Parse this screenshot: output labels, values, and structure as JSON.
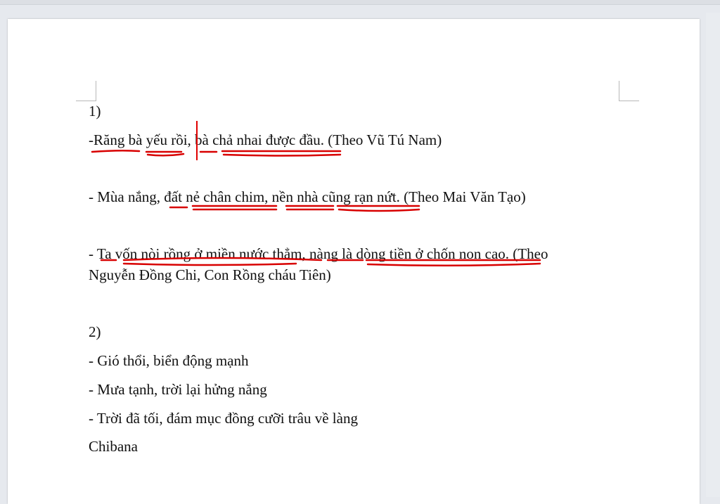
{
  "document": {
    "section1": {
      "heading": "1)",
      "line1": "-Răng bà yếu rồi, bà chả nhai được đầu. (Theo Vũ Tú Nam)",
      "line2": "- Mùa nắng, đất nẻ chân chim, nền nhà cũng rạn nứt. (Theo Mai Văn Tạo)",
      "line3a": " - Ta vốn nòi rồng ở miền nước thẳm, nàng là dòng tiền ở chốn non cao. (Theo",
      "line3b": "Nguyễn Đồng Chi, Con Rồng cháu Tiên)"
    },
    "section2": {
      "heading": "2)",
      "line1": "- Gió thổi, biển động mạnh",
      "line2": "- Mưa tạnh, trời lại hửng nắng",
      "line3": " - Trời đã tối, đám mục đồng cưỡi trâu về làng"
    },
    "signature": "Chibana"
  },
  "colors": {
    "underline": "#d80000",
    "page": "#ffffff",
    "background": "#e6e9ee"
  }
}
